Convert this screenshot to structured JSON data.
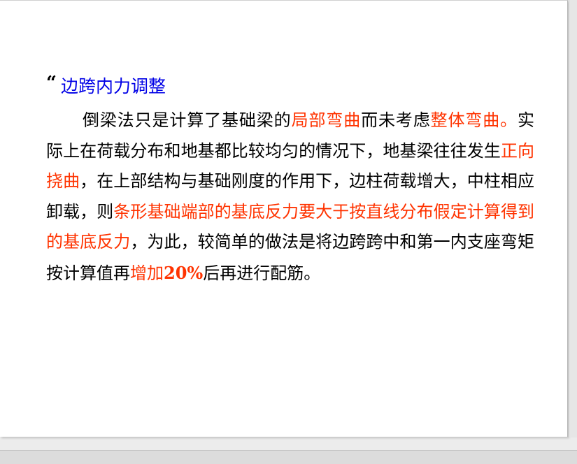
{
  "slide": {
    "heading": {
      "bullet": "“",
      "text": "边跨内力调整"
    },
    "paragraph": [
      {
        "text": "倒梁法只是计算了基础梁的",
        "style": "normal"
      },
      {
        "text": "局部弯曲",
        "style": "highlight"
      },
      {
        "text": "而未考虑",
        "style": "normal"
      },
      {
        "text": "整体弯曲。",
        "style": "highlight"
      },
      {
        "text": "实际上在荷载分布和地基都比较均匀的情况下，地基梁往往发生",
        "style": "normal"
      },
      {
        "text": "正向挠曲",
        "style": "highlight"
      },
      {
        "text": "，在上部结构与基础刚度的作用下，边柱荷载增大，中柱相应卸载，则",
        "style": "normal"
      },
      {
        "text": "条形基础端部的基底反力要大于按直线分布假定计算得到的基底反力",
        "style": "highlight"
      },
      {
        "text": "，为此，较简单的做法是将边跨跨中和第一内支座弯矩按计算值再",
        "style": "normal"
      },
      {
        "text": "增加",
        "style": "highlight"
      },
      {
        "text": "20%",
        "style": "highlight-bold"
      },
      {
        "text": "后再进行配筋。",
        "style": "normal"
      }
    ]
  },
  "colors": {
    "heading": "#0000e6",
    "highlight": "#ff3300",
    "text": "#000000",
    "slide_background": "#ffffff",
    "window_background": "#ececec"
  }
}
